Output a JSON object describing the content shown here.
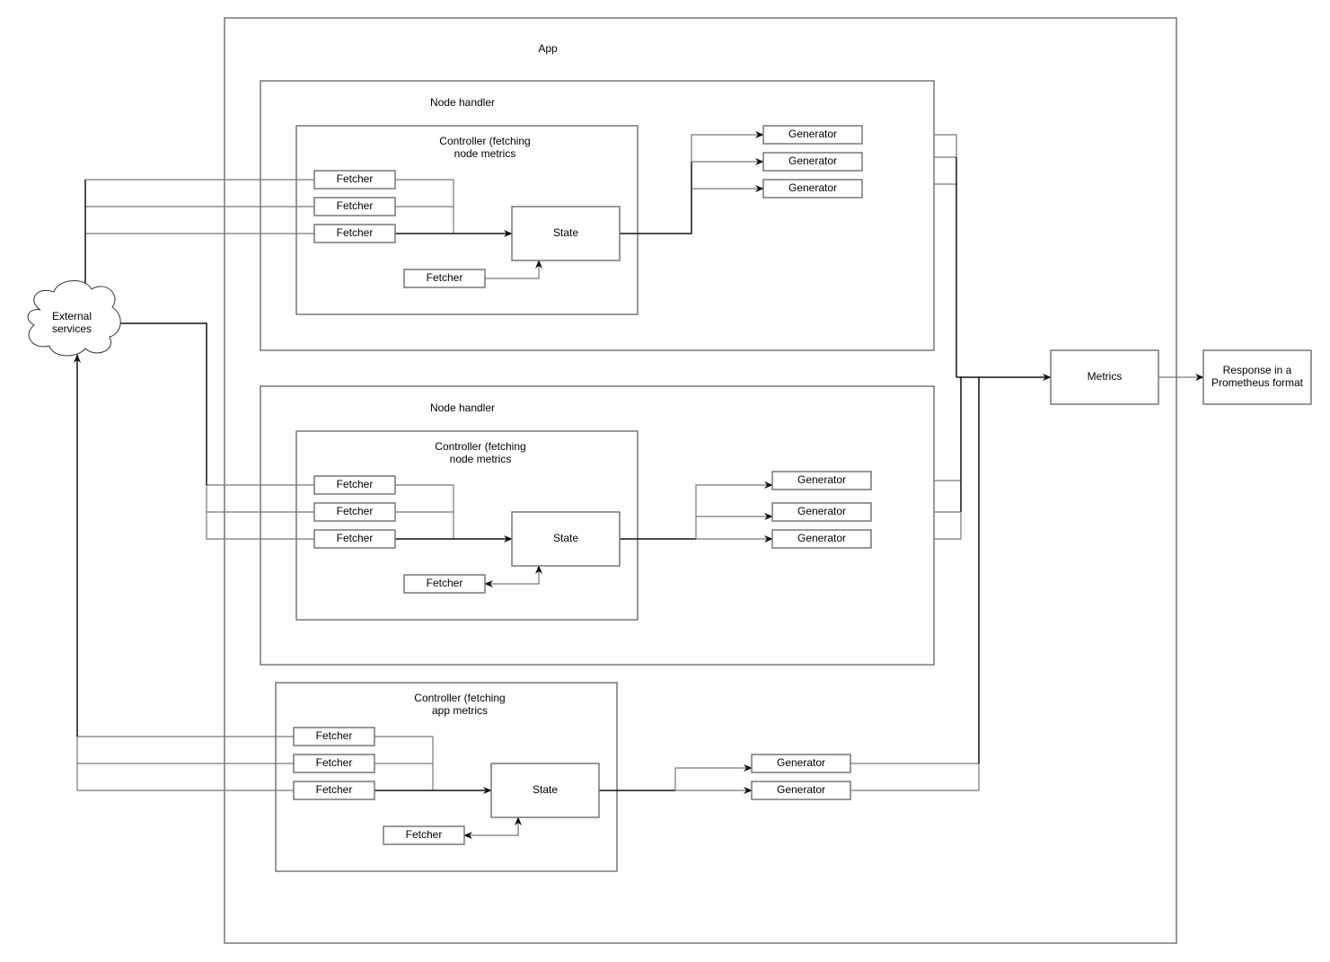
{
  "app": {
    "title": "App"
  },
  "external": {
    "line1": "External",
    "line2": "services"
  },
  "node_handlers": [
    {
      "title": "Node handler",
      "controller": {
        "line1": "Controller (fetching",
        "line2": "node metrics"
      },
      "fetchers": [
        "Fetcher",
        "Fetcher",
        "Fetcher",
        "Fetcher"
      ],
      "state": "State",
      "generators": [
        "Generator",
        "Generator",
        "Generator"
      ]
    },
    {
      "title": "Node handler",
      "controller": {
        "line1": "Controller (fetching",
        "line2": "node metrics"
      },
      "fetchers": [
        "Fetcher",
        "Fetcher",
        "Fetcher",
        "Fetcher"
      ],
      "state": "State",
      "generators": [
        "Generator",
        "Generator",
        "Generator"
      ]
    }
  ],
  "app_controller": {
    "line1": "Controller (fetching",
    "line2": "app metrics",
    "fetchers": [
      "Fetcher",
      "Fetcher",
      "Fetcher",
      "Fetcher"
    ],
    "state": "State",
    "generators": [
      "Generator",
      "Generator"
    ]
  },
  "metrics": "Metrics",
  "response": {
    "line1": "Response in a",
    "line2": "Prometheus format"
  }
}
